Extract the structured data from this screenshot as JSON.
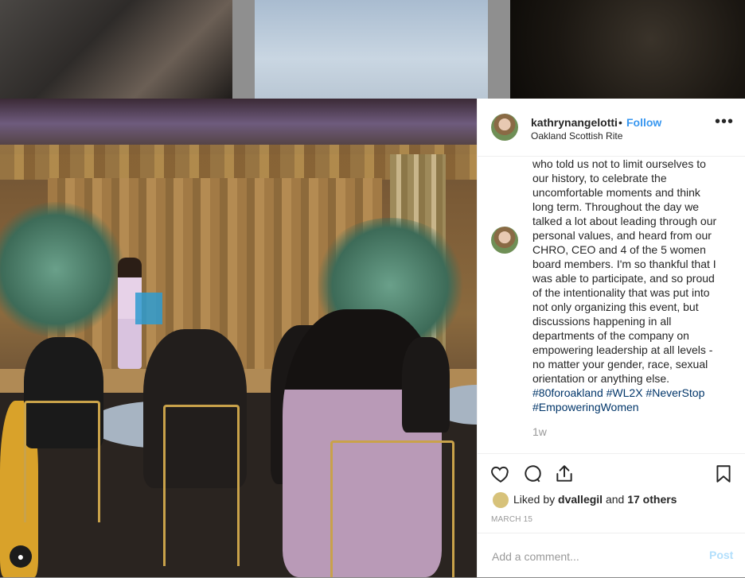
{
  "post": {
    "username": "kathrynangelotti",
    "separator": "•",
    "follow_label": "Follow",
    "location": "Oakland Scottish Rite",
    "more_label": "•••"
  },
  "caption": {
    "text": "who told us not to limit ourselves to our history, to celebrate the uncomfortable moments and think long term. Throughout the day we talked a lot about leading through our personal values, and heard from our CHRO, CEO and 4 of the 5 women board members. I'm so thankful that I was able to participate, and so proud of the intentionality that was put into not only organizing this event, but discussions happening in all departments of the company on empowering leadership at all levels - no matter your gender, race, sexual orientation or anything else.",
    "hashtags": "#80foroakland #WL2X #NeverStop #EmpoweringWomen",
    "time": "1w"
  },
  "likes": {
    "prefix": "Liked by",
    "user": "dvallegil",
    "middle": "and",
    "others": "17 others"
  },
  "date": "MARCH 15",
  "comment_box": {
    "placeholder": "Add a comment...",
    "post_label": "Post"
  },
  "icons": [
    "heart-icon",
    "comment-icon",
    "share-icon",
    "bookmark-icon",
    "profile-icon"
  ],
  "colors": {
    "link": "#3897f0",
    "hashtag": "#003569",
    "post_disabled": "#b2dffc"
  }
}
